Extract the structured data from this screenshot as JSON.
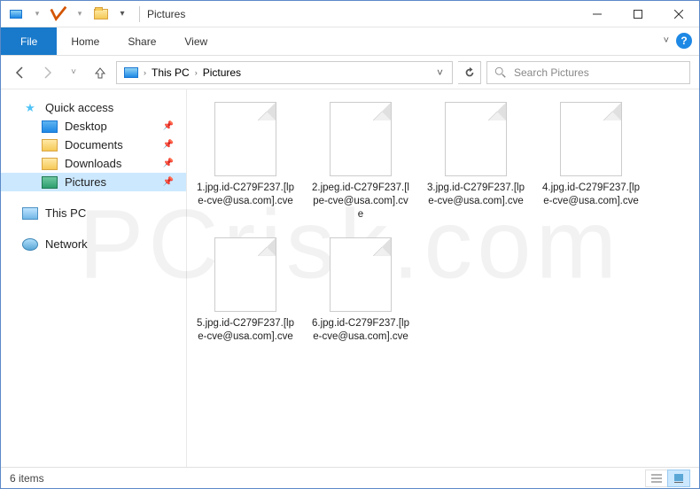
{
  "title": "Pictures",
  "tabs": {
    "file": "File",
    "home": "Home",
    "share": "Share",
    "view": "View"
  },
  "breadcrumb": {
    "root": "This PC",
    "folder": "Pictures"
  },
  "search": {
    "placeholder": "Search Pictures"
  },
  "sidebar": {
    "quick": "Quick access",
    "desktop": "Desktop",
    "documents": "Documents",
    "downloads": "Downloads",
    "pictures": "Pictures",
    "thispc": "This PC",
    "network": "Network"
  },
  "files": [
    {
      "name": "1.jpg.id-C279F237.[lpe-cve@usa.com].cve"
    },
    {
      "name": "2.jpeg.id-C279F237.[lpe-cve@usa.com].cve"
    },
    {
      "name": "3.jpg.id-C279F237.[lpe-cve@usa.com].cve"
    },
    {
      "name": "4.jpg.id-C279F237.[lpe-cve@usa.com].cve"
    },
    {
      "name": "5.jpg.id-C279F237.[lpe-cve@usa.com].cve"
    },
    {
      "name": "6.jpg.id-C279F237.[lpe-cve@usa.com].cve"
    }
  ],
  "status": "6 items"
}
